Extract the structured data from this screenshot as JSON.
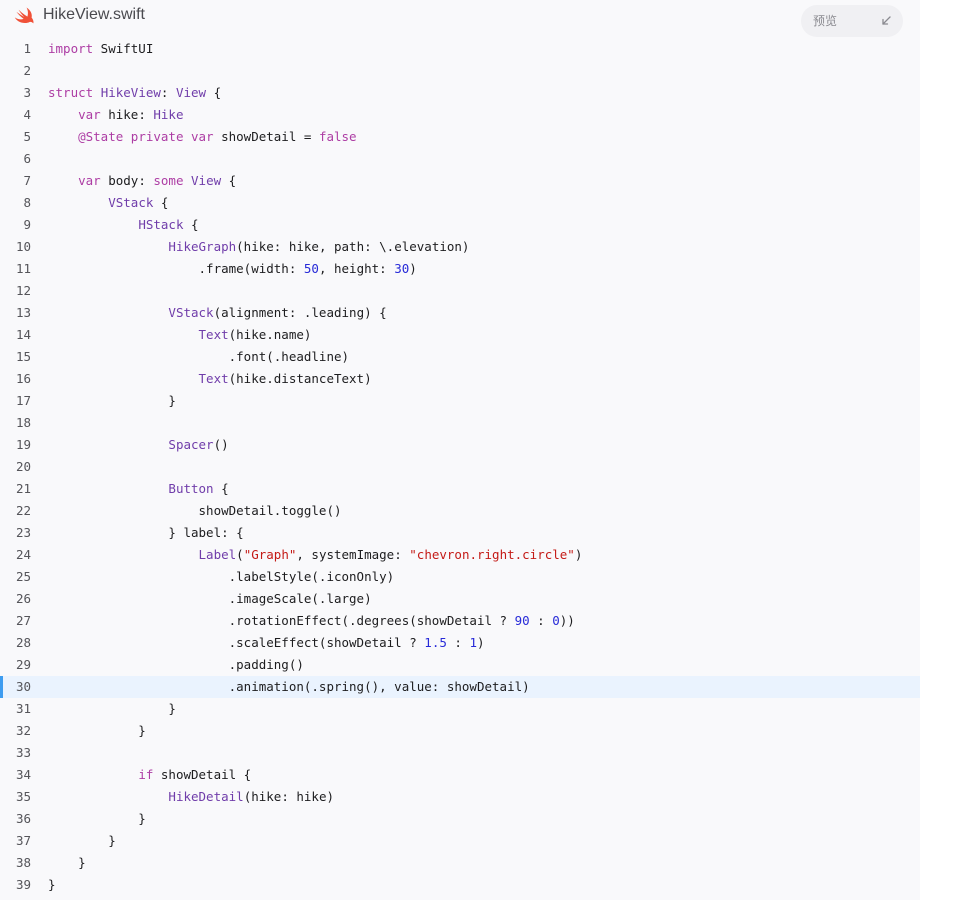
{
  "header": {
    "filename": "HikeView.swift",
    "preview_label": "预览",
    "icons": [
      "swift-logo-icon",
      "collapse-arrow-icon"
    ]
  },
  "colors": {
    "background": "#f9f9fb",
    "keyword": "#ad3da4",
    "type": "#703daa",
    "string": "#c41a16",
    "number": "#272ad8",
    "highlight_line_bg": "#eaf3fe",
    "highlight_line_marker": "#3d9cf0",
    "swift_logo": "#f05138"
  },
  "editor": {
    "highlighted_line": 30,
    "lines": [
      [
        [
          "kw",
          "import"
        ],
        [
          "p",
          " SwiftUI"
        ]
      ],
      [],
      [
        [
          "kw",
          "struct"
        ],
        [
          "p",
          " "
        ],
        [
          "ty",
          "HikeView"
        ],
        [
          "p",
          ": "
        ],
        [
          "ty",
          "View"
        ],
        [
          "p",
          " {"
        ]
      ],
      [
        [
          "p",
          "    "
        ],
        [
          "kw",
          "var"
        ],
        [
          "p",
          " hike: "
        ],
        [
          "ty",
          "Hike"
        ]
      ],
      [
        [
          "p",
          "    "
        ],
        [
          "kw",
          "@State private var"
        ],
        [
          "p",
          " showDetail = "
        ],
        [
          "kw",
          "false"
        ]
      ],
      [],
      [
        [
          "p",
          "    "
        ],
        [
          "kw",
          "var"
        ],
        [
          "p",
          " body: "
        ],
        [
          "kw",
          "some"
        ],
        [
          "p",
          " "
        ],
        [
          "ty",
          "View"
        ],
        [
          "p",
          " {"
        ]
      ],
      [
        [
          "p",
          "        "
        ],
        [
          "ty",
          "VStack"
        ],
        [
          "p",
          " {"
        ]
      ],
      [
        [
          "p",
          "            "
        ],
        [
          "ty",
          "HStack"
        ],
        [
          "p",
          " {"
        ]
      ],
      [
        [
          "p",
          "                "
        ],
        [
          "ty",
          "HikeGraph"
        ],
        [
          "p",
          "(hike: hike, path: \\.elevation)"
        ]
      ],
      [
        [
          "p",
          "                    .frame(width: "
        ],
        [
          "num",
          "50"
        ],
        [
          "p",
          ", height: "
        ],
        [
          "num",
          "30"
        ],
        [
          "p",
          ")"
        ]
      ],
      [],
      [
        [
          "p",
          "                "
        ],
        [
          "ty",
          "VStack"
        ],
        [
          "p",
          "(alignment: .leading) {"
        ]
      ],
      [
        [
          "p",
          "                    "
        ],
        [
          "ty",
          "Text"
        ],
        [
          "p",
          "(hike.name)"
        ]
      ],
      [
        [
          "p",
          "                        .font(.headline)"
        ]
      ],
      [
        [
          "p",
          "                    "
        ],
        [
          "ty",
          "Text"
        ],
        [
          "p",
          "(hike.distanceText)"
        ]
      ],
      [
        [
          "p",
          "                }"
        ]
      ],
      [],
      [
        [
          "p",
          "                "
        ],
        [
          "ty",
          "Spacer"
        ],
        [
          "p",
          "()"
        ]
      ],
      [],
      [
        [
          "p",
          "                "
        ],
        [
          "ty",
          "Button"
        ],
        [
          "p",
          " {"
        ]
      ],
      [
        [
          "p",
          "                    showDetail.toggle()"
        ]
      ],
      [
        [
          "p",
          "                } label: {"
        ]
      ],
      [
        [
          "p",
          "                    "
        ],
        [
          "ty",
          "Label"
        ],
        [
          "p",
          "("
        ],
        [
          "str",
          "\"Graph\""
        ],
        [
          "p",
          ", systemImage: "
        ],
        [
          "str",
          "\"chevron.right.circle\""
        ],
        [
          "p",
          ")"
        ]
      ],
      [
        [
          "p",
          "                        .labelStyle(.iconOnly)"
        ]
      ],
      [
        [
          "p",
          "                        .imageScale(.large)"
        ]
      ],
      [
        [
          "p",
          "                        .rotationEffect(.degrees(showDetail ? "
        ],
        [
          "num",
          "90"
        ],
        [
          "p",
          " : "
        ],
        [
          "num",
          "0"
        ],
        [
          "p",
          "))"
        ]
      ],
      [
        [
          "p",
          "                        .scaleEffect(showDetail ? "
        ],
        [
          "num",
          "1.5"
        ],
        [
          "p",
          " : "
        ],
        [
          "num",
          "1"
        ],
        [
          "p",
          ")"
        ]
      ],
      [
        [
          "p",
          "                        .padding()"
        ]
      ],
      [
        [
          "p",
          "                        .animation(.spring(), value: showDetail)"
        ]
      ],
      [
        [
          "p",
          "                }"
        ]
      ],
      [
        [
          "p",
          "            }"
        ]
      ],
      [],
      [
        [
          "p",
          "            "
        ],
        [
          "kw",
          "if"
        ],
        [
          "p",
          " showDetail {"
        ]
      ],
      [
        [
          "p",
          "                "
        ],
        [
          "ty",
          "HikeDetail"
        ],
        [
          "p",
          "(hike: hike)"
        ]
      ],
      [
        [
          "p",
          "            }"
        ]
      ],
      [
        [
          "p",
          "        }"
        ]
      ],
      [
        [
          "p",
          "    }"
        ]
      ],
      [
        [
          "p",
          "}"
        ]
      ]
    ]
  }
}
